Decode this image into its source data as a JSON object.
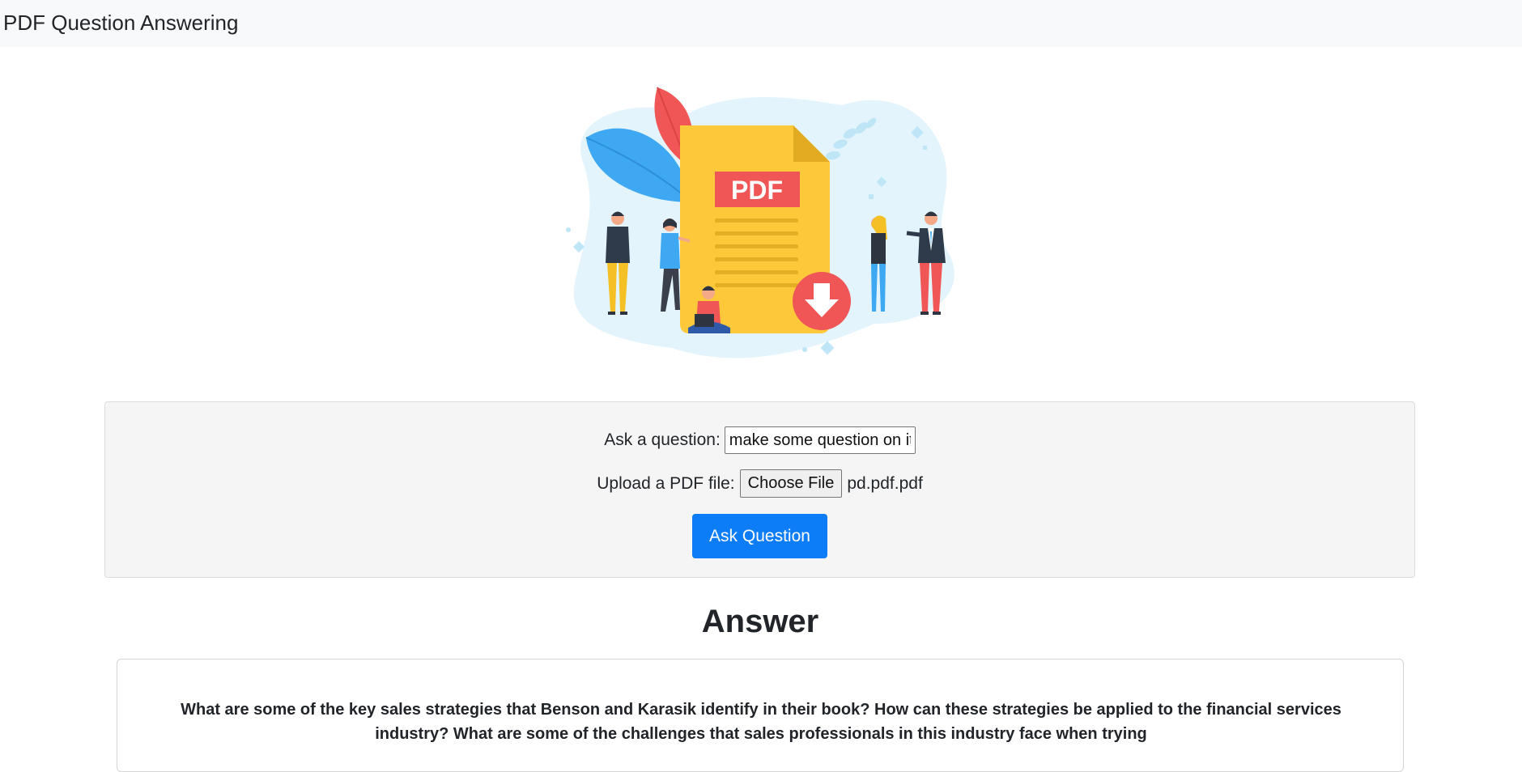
{
  "navbar": {
    "brand": "PDF Question Answering"
  },
  "illustration": {
    "badge_text": "PDF",
    "icon": "pdf-document-illustration"
  },
  "form": {
    "question_label": "Ask a question:",
    "question_value": "make some question on it",
    "upload_label": "Upload a PDF file:",
    "choose_file_label": "Choose File",
    "file_name": "pd.pdf.pdf",
    "submit_label": "Ask Question"
  },
  "answer": {
    "heading": "Answer",
    "text": "What are some of the key sales strategies that Benson and Karasik identify in their book? How can these strategies be applied to the financial services industry? What are some of the challenges that sales professionals in this industry face when trying"
  },
  "colors": {
    "navbar_bg": "#f8f9fa",
    "primary": "#0d7cf7",
    "card_bg": "#f5f5f5",
    "pdf_yellow": "#fdc93a",
    "pdf_red": "#f05656"
  }
}
